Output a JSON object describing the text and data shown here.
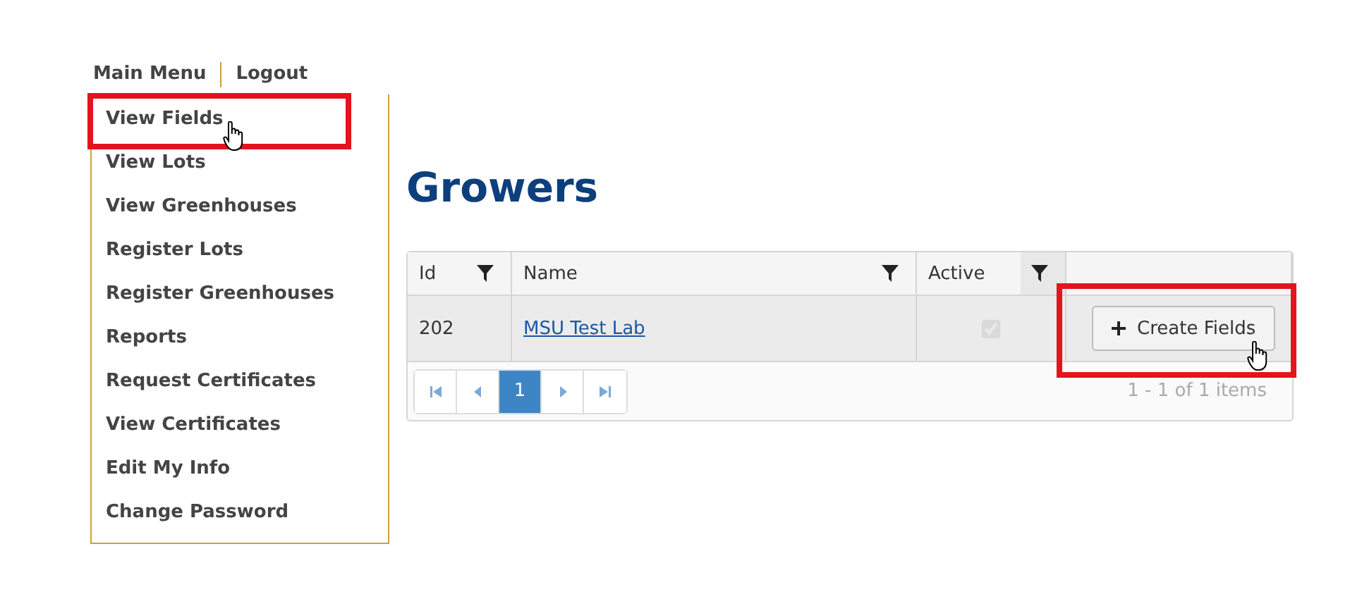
{
  "nav": [
    {
      "label": "Main Menu"
    },
    {
      "label": "Logout"
    }
  ],
  "menu": [
    {
      "label": "View Fields"
    },
    {
      "label": "View Lots"
    },
    {
      "label": "View Greenhouses"
    },
    {
      "label": "Register Lots"
    },
    {
      "label": "Register Greenhouses"
    },
    {
      "label": "Reports"
    },
    {
      "label": "Request Certificates"
    },
    {
      "label": "View Certificates"
    },
    {
      "label": "Edit My Info"
    },
    {
      "label": "Change Password"
    }
  ],
  "title": "Growers",
  "table": {
    "columns": [
      {
        "label": "Id",
        "filter": true
      },
      {
        "label": "Name",
        "filter": true
      },
      {
        "label": "Active",
        "filter": true
      }
    ],
    "rows": [
      {
        "id": "202",
        "name": "MSU Test Lab",
        "active": true,
        "action": "Create Fields"
      }
    ]
  },
  "pager": {
    "pages": [
      {
        "label": "1",
        "selected": true
      }
    ],
    "info": "1 - 1 of 1 items"
  }
}
